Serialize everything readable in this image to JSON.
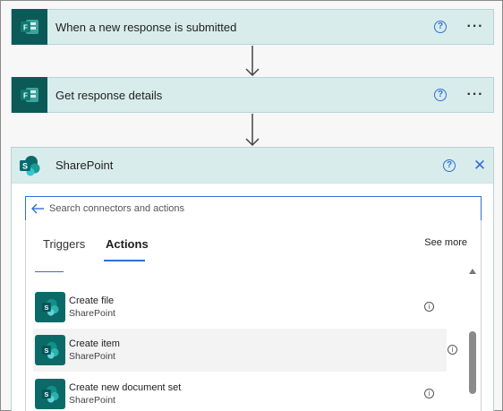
{
  "steps": [
    {
      "title": "When a new response is submitted",
      "help": "?",
      "more": "···"
    },
    {
      "title": "Get response details",
      "help": "?",
      "more": "···"
    }
  ],
  "sharepoint": {
    "title": "SharePoint",
    "help": "?",
    "close": "✕"
  },
  "search": {
    "placeholder": "Search connectors and actions"
  },
  "tabs": {
    "triggers": "Triggers",
    "actions": "Actions",
    "see_more": "See more"
  },
  "actions": [
    {
      "name": "Create file",
      "connector": "SharePoint"
    },
    {
      "name": "Create item",
      "connector": "SharePoint"
    },
    {
      "name": "Create new document set",
      "connector": "SharePoint"
    }
  ],
  "colors": {
    "accent": "#2f6fd6",
    "forms_brand": "#0b5a58",
    "sharepoint_brand": "#0b6a67",
    "step_header": "#d9ecec"
  },
  "icons": {
    "forms": "forms-icon",
    "sharepoint": "sharepoint-icon",
    "back": "arrow-left-icon",
    "info": "info-icon",
    "close": "close-icon"
  }
}
